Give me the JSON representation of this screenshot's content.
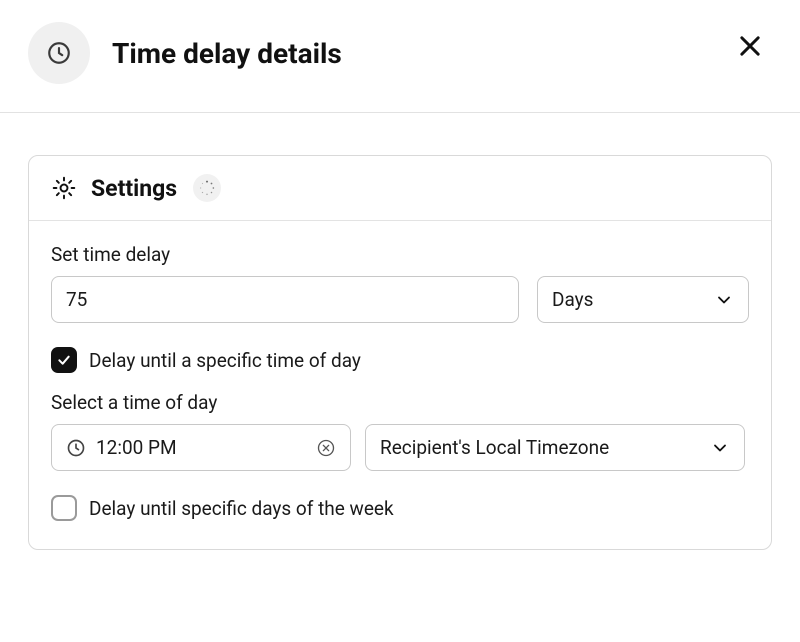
{
  "header": {
    "title": "Time delay details"
  },
  "card": {
    "title": "Settings"
  },
  "form": {
    "delay_label": "Set time delay",
    "delay_value": "75",
    "unit_value": "Days",
    "delay_time_checkbox_label": "Delay until a specific time of day",
    "delay_time_checked": true,
    "time_label": "Select a time of day",
    "time_value": "12:00 PM",
    "timezone_value": "Recipient's Local Timezone",
    "delay_days_checkbox_label": "Delay until specific days of the week",
    "delay_days_checked": false
  }
}
